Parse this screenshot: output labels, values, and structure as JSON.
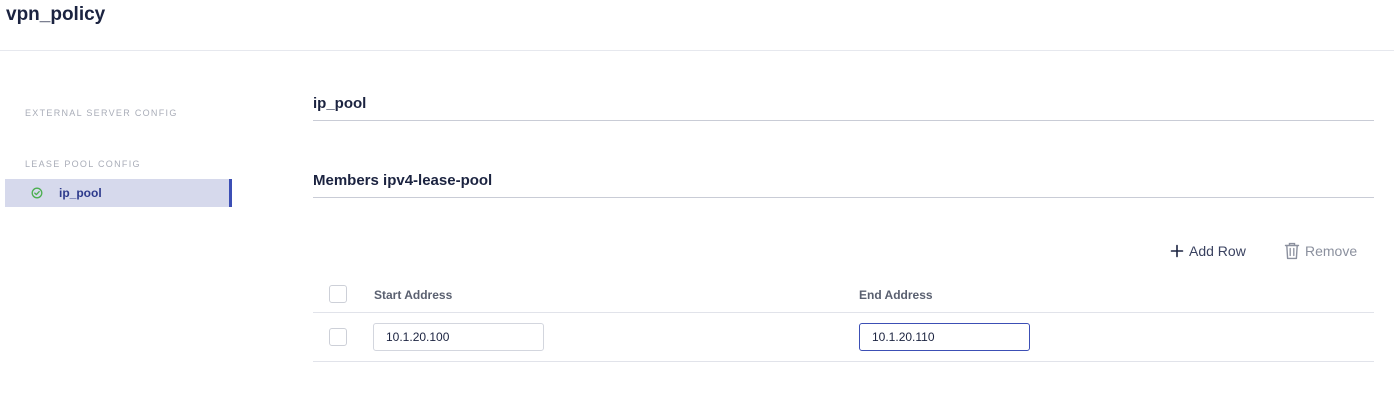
{
  "page": {
    "title": "vpn_policy"
  },
  "sidebar": {
    "groups": [
      {
        "label": "EXTERNAL SERVER CONFIG",
        "items": []
      },
      {
        "label": "LEASE POOL CONFIG",
        "items": [
          {
            "label": "ip_pool",
            "status": "valid",
            "active": true
          }
        ]
      }
    ]
  },
  "main": {
    "section_title": "ip_pool",
    "members_title": "Members ipv4-lease-pool",
    "actions": {
      "add_row": "Add Row",
      "remove": "Remove"
    },
    "table": {
      "columns": [
        "Start Address",
        "End Address"
      ],
      "rows": [
        {
          "start_address": "10.1.20.100",
          "end_address": "10.1.20.110"
        }
      ]
    }
  },
  "colors": {
    "accent": "#3c4fb5",
    "active_item_bg": "#d6d9ec",
    "valid_icon": "#4caf50"
  }
}
